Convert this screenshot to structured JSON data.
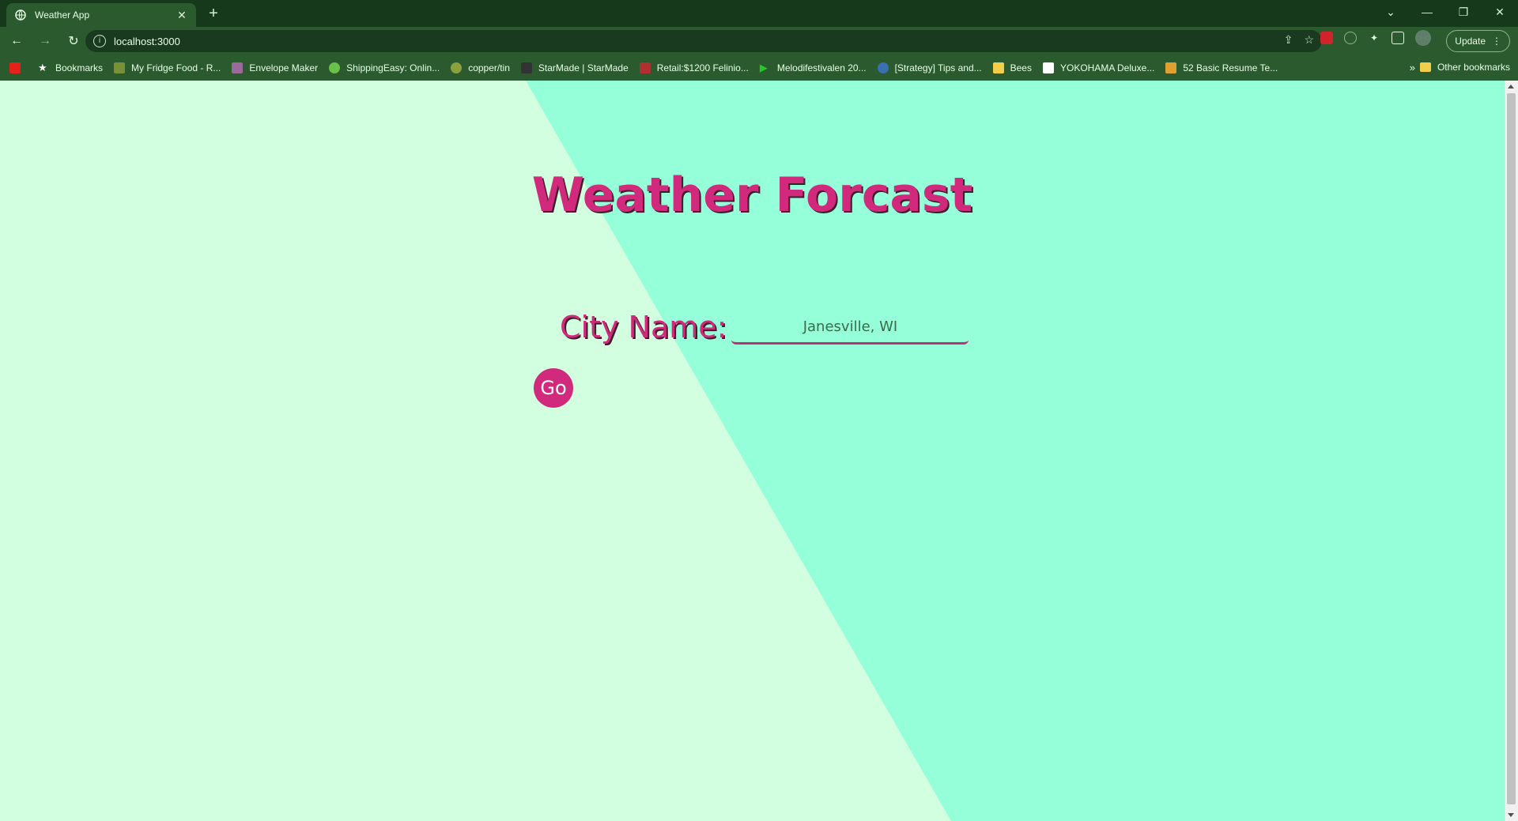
{
  "browser": {
    "tab_title": "Weather App",
    "url": "localhost:3000",
    "update_label": "Update"
  },
  "bookmarks": [
    {
      "label": "Bookmarks",
      "color": "#ffffff"
    },
    {
      "label": "My Fridge Food - R...",
      "color": "#7a8f3a"
    },
    {
      "label": "Envelope Maker",
      "color": "#9a6a9a"
    },
    {
      "label": "ShippingEasy: Onlin...",
      "color": "#6bbf4b"
    },
    {
      "label": "copper/tin",
      "color": "#8aa03a"
    },
    {
      "label": "StarMade | StarMade",
      "color": "#333333"
    },
    {
      "label": "Retail:$1200 Felinio...",
      "color": "#b03030"
    },
    {
      "label": "Melodifestivalen 20...",
      "color": "#28c628"
    },
    {
      "label": "[Strategy] Tips and...",
      "color": "#3a6fb0"
    },
    {
      "label": "Bees",
      "color": "#f2cf4a"
    },
    {
      "label": "YOKOHAMA Deluxe...",
      "color": "#111111"
    },
    {
      "label": "52 Basic Resume Te...",
      "color": "#e0a030"
    }
  ],
  "other_bookmarks_label": "Other bookmarks",
  "page": {
    "heading": "Weather Forcast",
    "city_label": "City Name:",
    "city_value": "Janesville, WI",
    "go_label": "Go"
  },
  "colors": {
    "bg_left": "#d2ffdf",
    "bg_right": "#94ffd8",
    "accent": "#d12a7c"
  }
}
